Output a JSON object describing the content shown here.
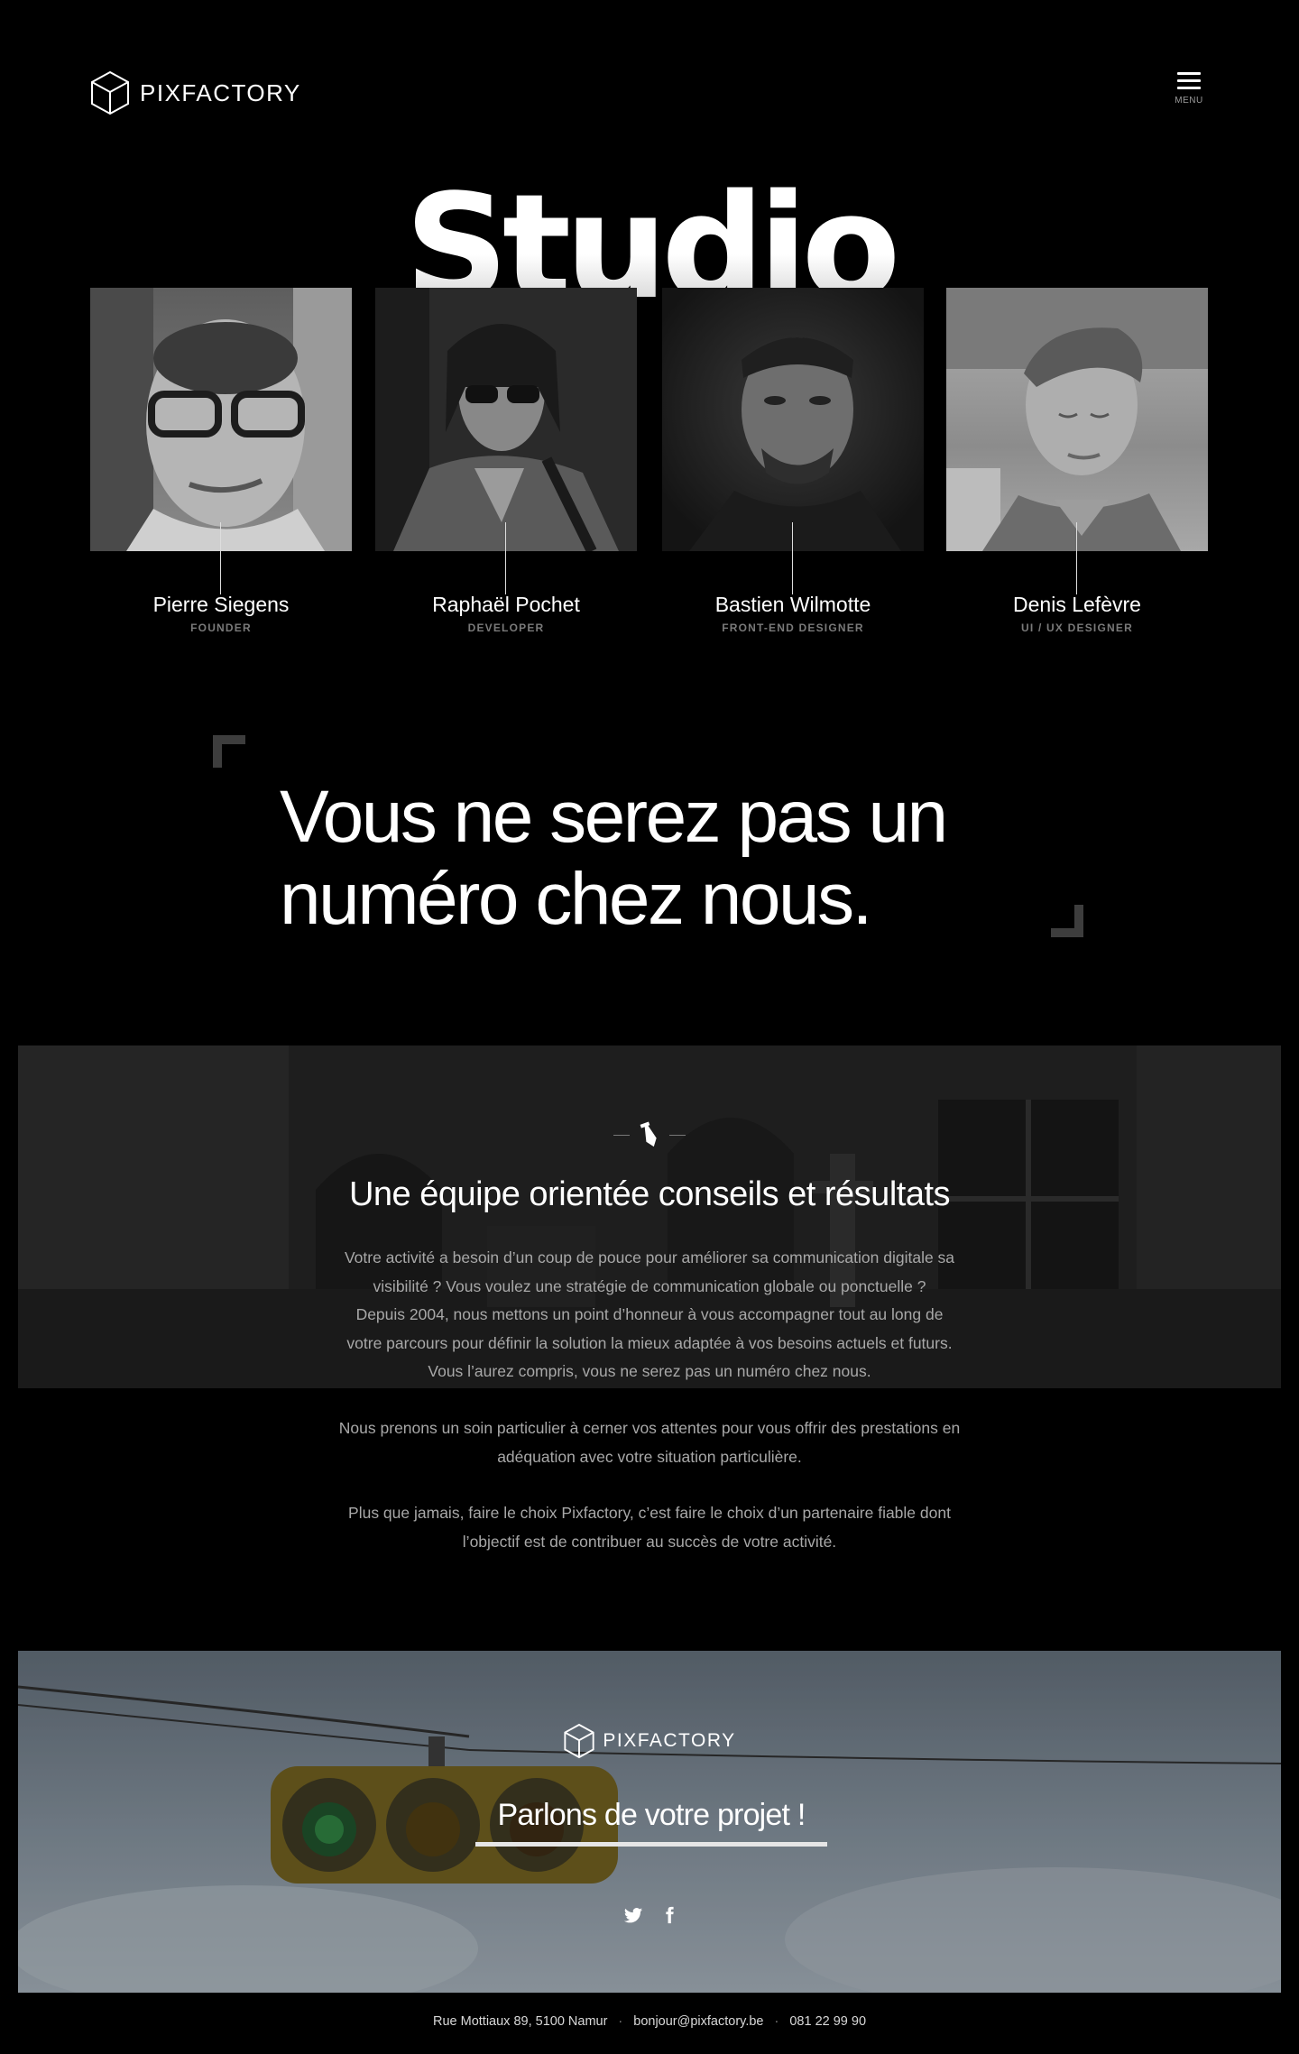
{
  "header": {
    "brand": "PIXFACTORY",
    "menu_label": "MENU"
  },
  "hero": {
    "title": "Studio"
  },
  "team": [
    {
      "name": "Pierre Siegens",
      "role": "FOUNDER"
    },
    {
      "name": "Raphaël Pochet",
      "role": "DEVELOPER"
    },
    {
      "name": "Bastien Wilmotte",
      "role": "FRONT-END DESIGNER"
    },
    {
      "name": "Denis Lefèvre",
      "role": "UI / UX DESIGNER"
    }
  ],
  "quote": {
    "line1": "Vous ne serez pas un",
    "line2": "numéro chez nous."
  },
  "conseils": {
    "title": "Une équipe orientée conseils et résultats",
    "p1_l1": "Votre activité a besoin d’un coup de pouce pour améliorer sa communication digitale sa",
    "p1_l2": "visibilité ? Vous voulez une stratégie de communication globale ou ponctuelle ?",
    "p1_l3": "Depuis 2004, nous mettons un point d’honneur à vous accompagner tout au long de",
    "p1_l4": "votre parcours pour définir la solution la mieux adaptée à vos besoins actuels et futurs.",
    "p1_l5": "Vous l’aurez compris, vous ne serez pas un numéro chez nous.",
    "p2_l1": "Nous prenons un soin particulier à cerner vos attentes pour vous offrir des prestations en",
    "p2_l2": "adéquation avec votre situation particulière.",
    "p3_l1": "Plus que jamais, faire le choix Pixfactory, c’est faire le choix d’un partenaire fiable dont",
    "p3_l2": "l’objectif est de contribuer au succès de votre activité."
  },
  "cta": {
    "brand": "PIXFACTORY",
    "link": "Parlons de votre projet !"
  },
  "footer": {
    "address": "Rue Mottiaux 89, 5100 Namur",
    "email": "bonjour@pixfactory.be",
    "phone": "081 22 99 90"
  }
}
